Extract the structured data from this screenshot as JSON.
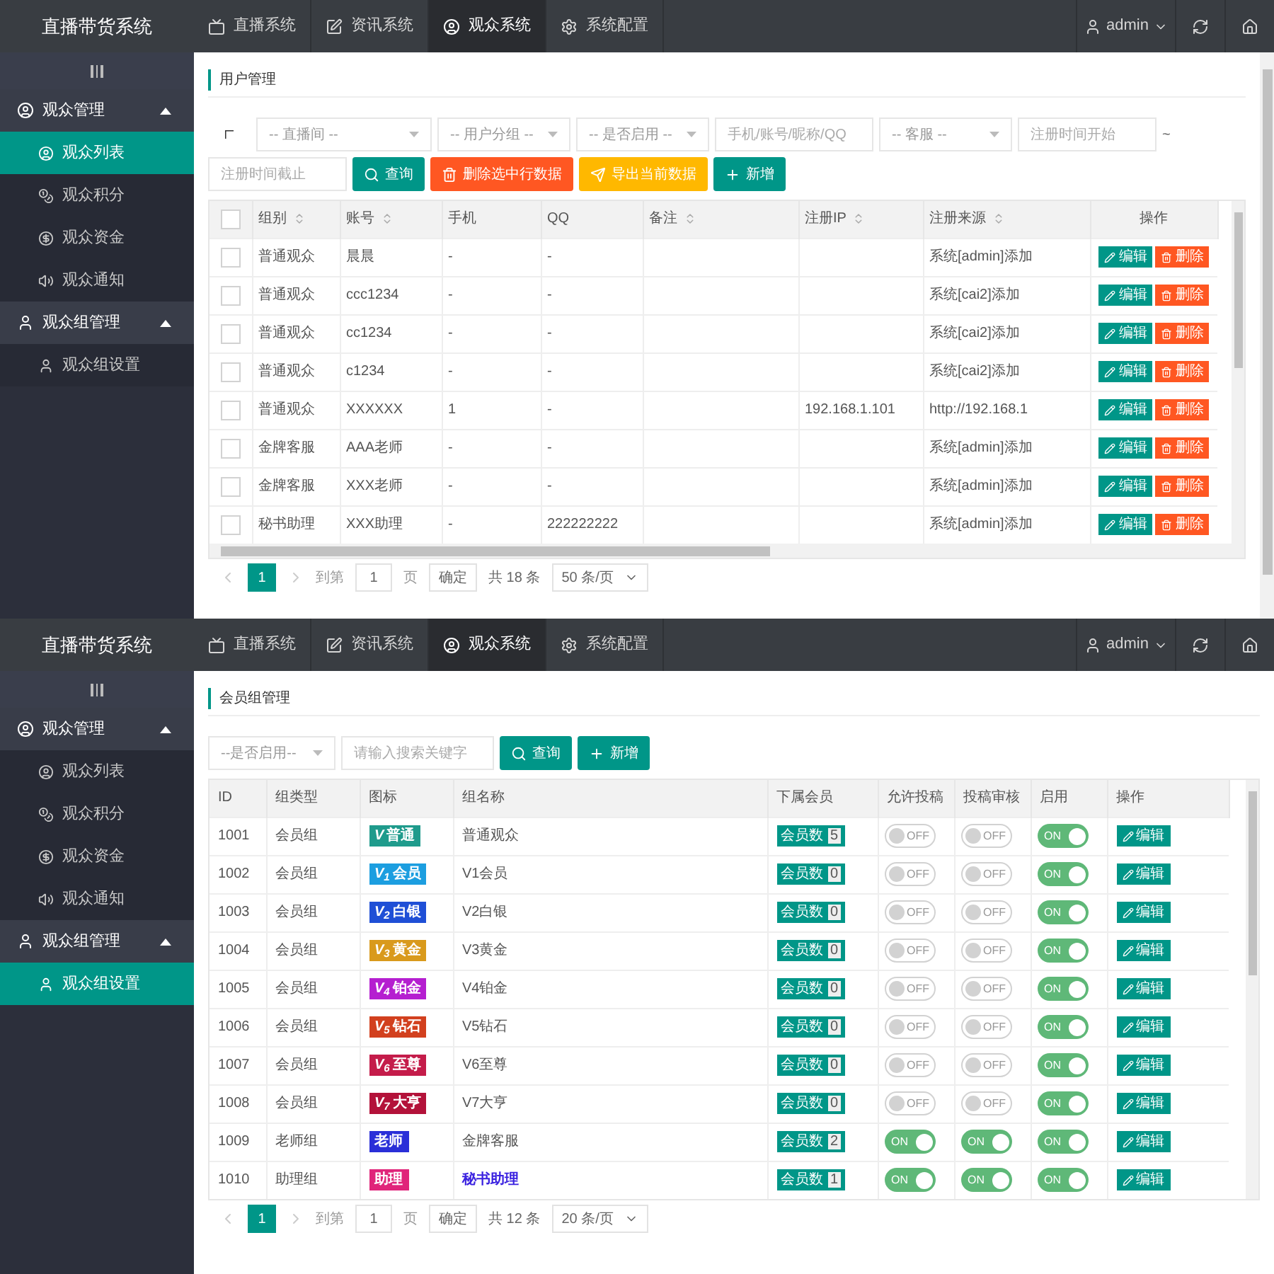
{
  "panels": [
    {
      "kind": "users",
      "header": {
        "brand": "直播带货系统",
        "tabs": [
          {
            "label": "直播系统",
            "selected": false
          },
          {
            "label": "资讯系统",
            "selected": false
          },
          {
            "label": "观众系统",
            "selected": true
          },
          {
            "label": "系统配置",
            "selected": false
          }
        ],
        "user": "admin"
      },
      "sidebar": {
        "groups": [
          {
            "label": "观众管理",
            "expanded": true,
            "items": [
              {
                "label": "观众列表",
                "selected": true
              },
              {
                "label": "观众积分",
                "selected": false
              },
              {
                "label": "观众资金",
                "selected": false
              },
              {
                "label": "观众通知",
                "selected": false
              }
            ]
          },
          {
            "label": "观众组管理",
            "expanded": true,
            "items": [
              {
                "label": "观众组设置",
                "selected": false
              }
            ]
          }
        ]
      },
      "title": "用户管理",
      "filters": [
        {
          "kind": "select",
          "text": "-- 直播间 --"
        },
        {
          "kind": "select",
          "text": "-- 用户分组 --"
        },
        {
          "kind": "select",
          "text": "-- 是否启用 --"
        },
        {
          "kind": "input",
          "placeholder": "手机/账号/昵称/QQ"
        },
        {
          "kind": "select",
          "text": "-- 客服 --"
        },
        {
          "kind": "input",
          "placeholder": "注册时间开始"
        },
        {
          "kind": "text",
          "text": "~"
        },
        {
          "kind": "input",
          "placeholder": "注册时间截止"
        }
      ],
      "buttons": [
        {
          "kind": "search",
          "label": "查询"
        },
        {
          "kind": "delete",
          "label": "删除选中行数据"
        },
        {
          "kind": "export",
          "label": "导出当前数据"
        },
        {
          "kind": "add",
          "label": "新增"
        }
      ],
      "table": {
        "all_checked": false,
        "columns": [
          {
            "label": "组别",
            "sortable": true
          },
          {
            "label": "账号",
            "sortable": true
          },
          {
            "label": "手机",
            "sortable": false
          },
          {
            "label": "QQ",
            "sortable": false
          },
          {
            "label": "备注",
            "sortable": true
          },
          {
            "label": "注册IP",
            "sortable": true
          },
          {
            "label": "注册来源",
            "sortable": true
          },
          {
            "label": "操作",
            "sortable": false
          }
        ],
        "rows": [
          {
            "checked": false,
            "cells": [
              "普通观众",
              "晨晨",
              "-",
              "-",
              "",
              "",
              "系统[admin]添加"
            ],
            "actions": [
              "编辑",
              "删除"
            ]
          },
          {
            "checked": false,
            "cells": [
              "普通观众",
              "ccc1234",
              "-",
              "-",
              "",
              "",
              "系统[cai2]添加"
            ],
            "actions": [
              "编辑",
              "删除"
            ]
          },
          {
            "checked": false,
            "cells": [
              "普通观众",
              "cc1234",
              "-",
              "-",
              "",
              "",
              "系统[cai2]添加"
            ],
            "actions": [
              "编辑",
              "删除"
            ]
          },
          {
            "checked": false,
            "cells": [
              "普通观众",
              "c1234",
              "-",
              "-",
              "",
              "",
              "系统[cai2]添加"
            ],
            "actions": [
              "编辑",
              "删除"
            ]
          },
          {
            "checked": false,
            "cells": [
              "普通观众",
              "XXXXXX",
              "1",
              "-",
              "",
              "192.168.1.101",
              "http://192.168.1"
            ],
            "actions": [
              "编辑",
              "删除"
            ]
          },
          {
            "checked": false,
            "cells": [
              "金牌客服",
              "AAA老师",
              "-",
              "-",
              "",
              "",
              "系统[admin]添加"
            ],
            "actions": [
              "编辑",
              "删除"
            ]
          },
          {
            "checked": false,
            "cells": [
              "金牌客服",
              "XXX老师",
              "-",
              "-",
              "",
              "",
              "系统[admin]添加"
            ],
            "actions": [
              "编辑",
              "删除"
            ]
          },
          {
            "checked": false,
            "cells": [
              "秘书助理",
              "XXX助理",
              "-",
              "222222222",
              "",
              "",
              "系统[admin]添加"
            ],
            "actions": [
              "编辑",
              "删除"
            ]
          }
        ]
      },
      "pagination": {
        "pages": [
          {
            "label": "1",
            "selected": true
          }
        ],
        "goto_label": "到第",
        "page_value": "1",
        "page_unit": "页",
        "confirm": "确定",
        "total": "共 18 条",
        "page_size": "50 条/页"
      }
    },
    {
      "kind": "groups",
      "header": {
        "brand": "直播带货系统",
        "tabs": [
          {
            "label": "直播系统",
            "selected": false
          },
          {
            "label": "资讯系统",
            "selected": false
          },
          {
            "label": "观众系统",
            "selected": true
          },
          {
            "label": "系统配置",
            "selected": false
          }
        ],
        "user": "admin"
      },
      "sidebar": {
        "groups": [
          {
            "label": "观众管理",
            "expanded": true,
            "items": [
              {
                "label": "观众列表",
                "selected": false
              },
              {
                "label": "观众积分",
                "selected": false
              },
              {
                "label": "观众资金",
                "selected": false
              },
              {
                "label": "观众通知",
                "selected": false
              }
            ]
          },
          {
            "label": "观众组管理",
            "expanded": true,
            "items": [
              {
                "label": "观众组设置",
                "selected": true
              }
            ]
          }
        ]
      },
      "title": "会员组管理",
      "filters": [
        {
          "kind": "select",
          "text": "--是否启用--"
        },
        {
          "kind": "input",
          "placeholder": "请输入搜索关键字"
        }
      ],
      "buttons": [
        {
          "kind": "search",
          "label": "查询"
        },
        {
          "kind": "add",
          "label": "新增"
        }
      ],
      "table": {
        "columns": [
          {
            "label": "ID"
          },
          {
            "label": "组类型"
          },
          {
            "label": "图标"
          },
          {
            "label": "组名称"
          },
          {
            "label": "下属会员"
          },
          {
            "label": "允许投稿"
          },
          {
            "label": "投稿审核"
          },
          {
            "label": "启用"
          },
          {
            "label": "操作"
          }
        ],
        "rows": [
          {
            "id": "1001",
            "type": "会员组",
            "badge": {
              "mark": "V",
              "text": "普通",
              "color": "#1f9b8c"
            },
            "name": "普通观众",
            "members_label": "会员数",
            "members": "5",
            "allow": {
              "on": false,
              "label": "OFF"
            },
            "review": {
              "on": false,
              "label": "OFF"
            },
            "enabled": {
              "on": true,
              "label": "ON"
            },
            "action": "编辑"
          },
          {
            "id": "1002",
            "type": "会员组",
            "badge": {
              "mark": "V$_{1}$",
              "text": "会员",
              "color": "#1c9ee0"
            },
            "name": "V1会员",
            "members_label": "会员数",
            "members": "0",
            "allow": {
              "on": false,
              "label": "OFF"
            },
            "review": {
              "on": false,
              "label": "OFF"
            },
            "enabled": {
              "on": true,
              "label": "ON"
            },
            "action": "编辑"
          },
          {
            "id": "1003",
            "type": "会员组",
            "badge": {
              "mark": "V$_{2}$",
              "text": "白银",
              "color": "#1f4fd6"
            },
            "name": "V2白银",
            "members_label": "会员数",
            "members": "0",
            "allow": {
              "on": false,
              "label": "OFF"
            },
            "review": {
              "on": false,
              "label": "OFF"
            },
            "enabled": {
              "on": true,
              "label": "ON"
            },
            "action": "编辑"
          },
          {
            "id": "1004",
            "type": "会员组",
            "badge": {
              "mark": "V$_{3}$",
              "text": "黄金",
              "color": "#d99a1c"
            },
            "name": "V3黄金",
            "members_label": "会员数",
            "members": "0",
            "allow": {
              "on": false,
              "label": "OFF"
            },
            "review": {
              "on": false,
              "label": "OFF"
            },
            "enabled": {
              "on": true,
              "label": "ON"
            },
            "action": "编辑"
          },
          {
            "id": "1005",
            "type": "会员组",
            "badge": {
              "mark": "V$_{4}$",
              "text": "铂金",
              "color": "#b51fd0"
            },
            "name": "V4铂金",
            "members_label": "会员数",
            "members": "0",
            "allow": {
              "on": false,
              "label": "OFF"
            },
            "review": {
              "on": false,
              "label": "OFF"
            },
            "enabled": {
              "on": true,
              "label": "ON"
            },
            "action": "编辑"
          },
          {
            "id": "1006",
            "type": "会员组",
            "badge": {
              "mark": "V$_{5}$",
              "text": "钻石",
              "color": "#d2401e"
            },
            "name": "V5钻石",
            "members_label": "会员数",
            "members": "0",
            "allow": {
              "on": false,
              "label": "OFF"
            },
            "review": {
              "on": false,
              "label": "OFF"
            },
            "enabled": {
              "on": true,
              "label": "ON"
            },
            "action": "编辑"
          },
          {
            "id": "1007",
            "type": "会员组",
            "badge": {
              "mark": "V$_{6}$",
              "text": "至尊",
              "color": "#c41c4a"
            },
            "name": "V6至尊",
            "members_label": "会员数",
            "members": "0",
            "allow": {
              "on": false,
              "label": "OFF"
            },
            "review": {
              "on": false,
              "label": "OFF"
            },
            "enabled": {
              "on": true,
              "label": "ON"
            },
            "action": "编辑"
          },
          {
            "id": "1008",
            "type": "会员组",
            "badge": {
              "mark": "V$_{7}$",
              "text": "大亨",
              "color": "#b3123a"
            },
            "name": "V7大亨",
            "members_label": "会员数",
            "members": "0",
            "allow": {
              "on": false,
              "label": "OFF"
            },
            "review": {
              "on": false,
              "label": "OFF"
            },
            "enabled": {
              "on": true,
              "label": "ON"
            },
            "action": "编辑"
          },
          {
            "id": "1009",
            "type": "老师组",
            "badge": {
              "text": "老师",
              "color": "#2a2fd8"
            },
            "name": "金牌客服",
            "members_label": "会员数",
            "members": "2",
            "allow": {
              "on": true,
              "label": "ON"
            },
            "review": {
              "on": true,
              "label": "ON"
            },
            "enabled": {
              "on": true,
              "label": "ON"
            },
            "action": "编辑"
          },
          {
            "id": "1010",
            "type": "助理组",
            "badge": {
              "text": "助理",
              "color": "#e0247a"
            },
            "name": "秘书助理",
            "highlight": true,
            "members_label": "会员数",
            "members": "1",
            "allow": {
              "on": true,
              "label": "ON"
            },
            "review": {
              "on": true,
              "label": "ON"
            },
            "enabled": {
              "on": true,
              "label": "ON"
            },
            "action": "编辑"
          }
        ]
      },
      "pagination": {
        "pages": [
          {
            "label": "1",
            "selected": true
          }
        ],
        "goto_label": "到第",
        "page_value": "1",
        "page_unit": "页",
        "confirm": "确定",
        "total": "共 12 条",
        "page_size": "20 条/页"
      }
    }
  ]
}
